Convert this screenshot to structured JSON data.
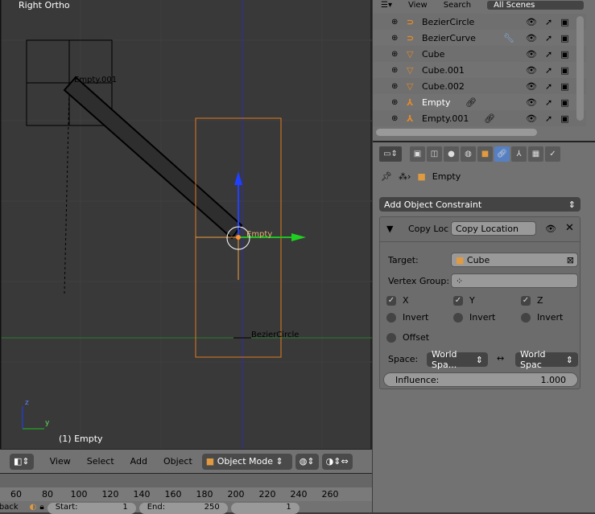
{
  "viewport": {
    "title": "Right Ortho",
    "status": "(1) Empty",
    "labels": {
      "empty001": "Empty.001",
      "empty": "Empty",
      "bezier": "BezierCircle"
    },
    "axis_z": "z",
    "axis_y": "y"
  },
  "header3d": {
    "menus": [
      "View",
      "Select",
      "Add",
      "Object"
    ],
    "mode": "Object Mode"
  },
  "timeline": {
    "ticks": [
      "60",
      "80",
      "100",
      "120",
      "140",
      "160",
      "180",
      "200",
      "220",
      "240",
      "260"
    ],
    "playback": "Playback",
    "start_label": "Start:",
    "start": "1",
    "end_label": "End:",
    "end": "250",
    "current": "1"
  },
  "outliner": {
    "menus": [
      "View",
      "Search"
    ],
    "scene": "All Scenes",
    "items": [
      {
        "name": "BezierCircle",
        "icon": "curve"
      },
      {
        "name": "BezierCurve",
        "icon": "curve"
      },
      {
        "name": "Cube",
        "icon": "mesh"
      },
      {
        "name": "Cube.001",
        "icon": "mesh"
      },
      {
        "name": "Cube.002",
        "icon": "mesh"
      },
      {
        "name": "Empty",
        "icon": "empty"
      },
      {
        "name": "Empty.001",
        "icon": "empty"
      }
    ]
  },
  "properties": {
    "breadcrumb": "Empty",
    "add_constraint": "Add Object Constraint",
    "constraint": {
      "type": "Copy Loc",
      "name": "Copy Location",
      "target_label": "Target:",
      "target": "Cube",
      "vgroup_label": "Vertex Group:",
      "x": "X",
      "y": "Y",
      "z": "Z",
      "invert": "Invert",
      "offset": "Offset",
      "space_label": "Space:",
      "owner_space": "World Spa...",
      "target_space": "World Spac",
      "arrow": "↔",
      "influence_label": "Influence:",
      "influence": "1.000"
    }
  }
}
